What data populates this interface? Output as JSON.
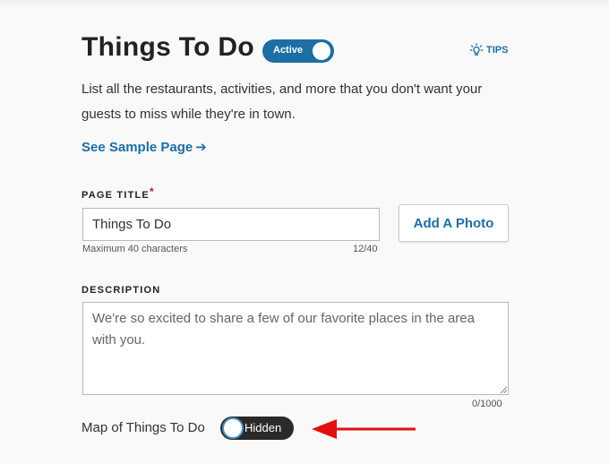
{
  "header": {
    "title": "Things To Do",
    "status_toggle_label": "Active",
    "tips_label": "TIPS"
  },
  "intro_text": "List all the restaurants, activities, and more that you don't want your guests to miss while they're in town.",
  "sample_link": {
    "label": "See Sample Page",
    "arrow": "➔"
  },
  "page_title_field": {
    "label": "PAGE TITLE",
    "required_mark": "*",
    "value": "Things To Do",
    "hint": "Maximum 40 characters",
    "counter": "12/40"
  },
  "add_photo_button": "Add A Photo",
  "description_field": {
    "label": "DESCRIPTION",
    "placeholder": "We're so excited to share a few of our favorite places in the area with you.",
    "counter": "0/1000"
  },
  "map_toggle": {
    "label": "Map of Things To Do",
    "state_label": "Hidden"
  },
  "colors": {
    "accent": "#1d6ea3",
    "required": "#c0172a",
    "annotation_arrow": "#e01010"
  }
}
